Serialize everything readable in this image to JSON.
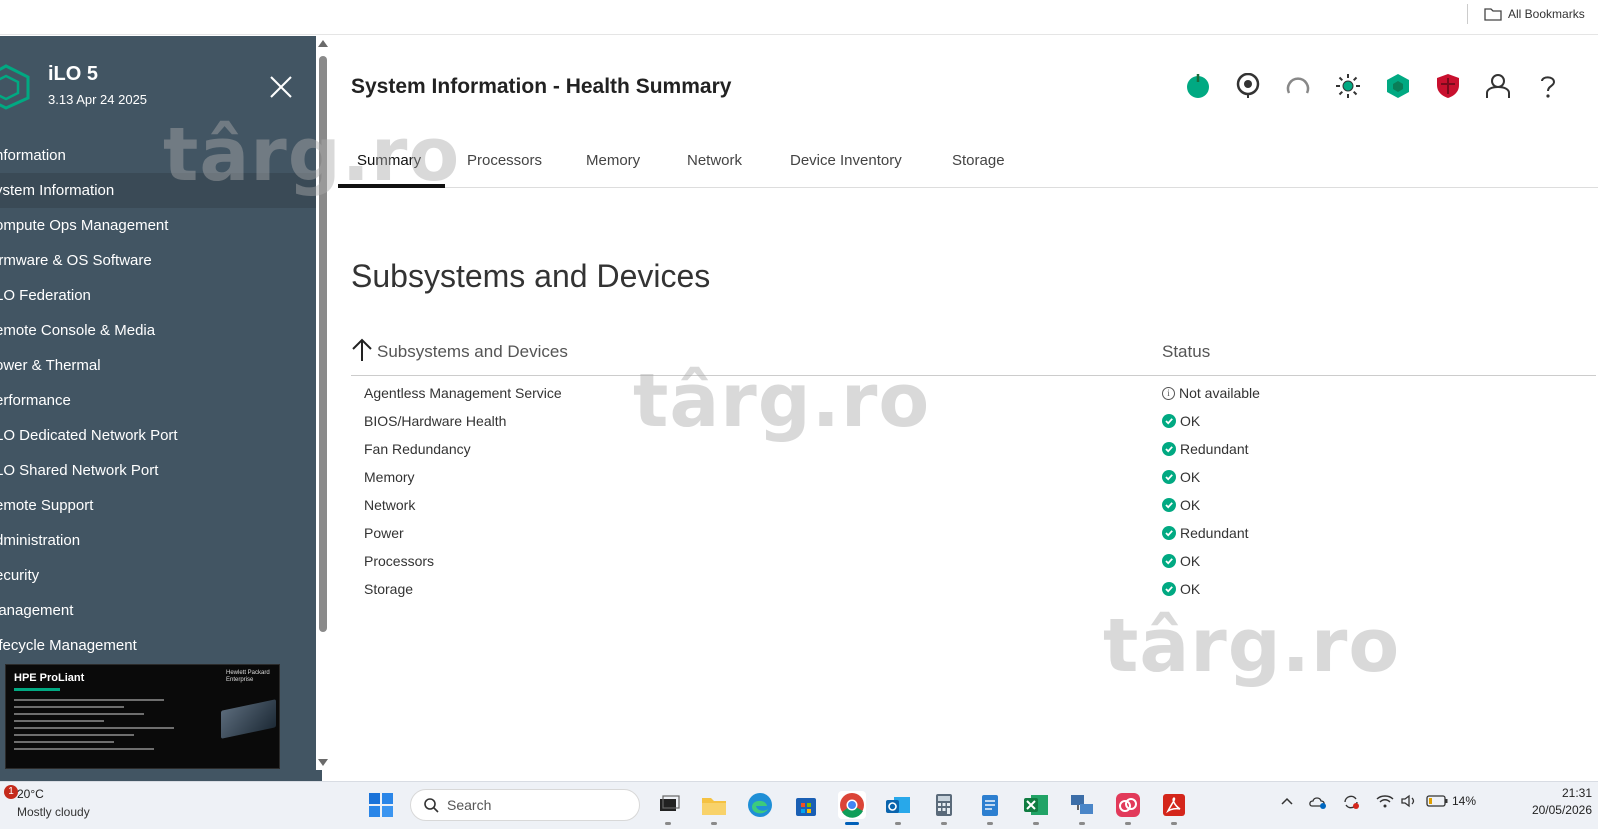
{
  "browser": {
    "bookmarks_label": "All Bookmarks"
  },
  "sidebar": {
    "brand_title": "iLO 5",
    "brand_version": "3.13 Apr 24 2025",
    "items": [
      {
        "label": "nformation"
      },
      {
        "label": "ystem Information"
      },
      {
        "label": "ompute Ops Management"
      },
      {
        "label": "irmware & OS Software"
      },
      {
        "label": "LO Federation"
      },
      {
        "label": "emote Console & Media"
      },
      {
        "label": "ower & Thermal"
      },
      {
        "label": "erformance"
      },
      {
        "label": "LO Dedicated Network Port"
      },
      {
        "label": "LO Shared Network Port"
      },
      {
        "label": "emote Support"
      },
      {
        "label": "dministration"
      },
      {
        "label": "ecurity"
      },
      {
        "label": "lanagement"
      },
      {
        "label": "ifecycle Management"
      }
    ],
    "thumbnail": {
      "title": "HPE ProLiant",
      "brand": "Hewlett Packard Enterprise"
    }
  },
  "header": {
    "title": "System Information - Health Summary"
  },
  "status_icons": [
    "power-icon",
    "uid-indicator-icon",
    "loading-spinner-icon",
    "health-sun-icon",
    "health-hexagon-icon",
    "security-shield-icon",
    "user-icon",
    "help-icon"
  ],
  "tabs": [
    {
      "label": "Summary"
    },
    {
      "label": "Processors"
    },
    {
      "label": "Memory"
    },
    {
      "label": "Network"
    },
    {
      "label": "Device Inventory"
    },
    {
      "label": "Storage"
    }
  ],
  "section": {
    "title": "Subsystems and Devices"
  },
  "table": {
    "columns": [
      "Subsystems and Devices",
      "Status"
    ],
    "rows": [
      {
        "name": "Agentless Management Service",
        "status": "Not available",
        "state": "info"
      },
      {
        "name": "BIOS/Hardware Health",
        "status": "OK",
        "state": "ok"
      },
      {
        "name": "Fan Redundancy",
        "status": "Redundant",
        "state": "ok"
      },
      {
        "name": "Memory",
        "status": "OK",
        "state": "ok"
      },
      {
        "name": "Network",
        "status": "OK",
        "state": "ok"
      },
      {
        "name": "Power",
        "status": "Redundant",
        "state": "ok"
      },
      {
        "name": "Processors",
        "status": "OK",
        "state": "ok"
      },
      {
        "name": "Storage",
        "status": "OK",
        "state": "ok"
      }
    ]
  },
  "watermark": "târg.ro",
  "taskbar": {
    "weather_badge": "1",
    "weather_temp": "20°C",
    "weather_desc": "Mostly cloudy",
    "search_placeholder": "Search",
    "battery": "14%",
    "time": "21:31",
    "date": "20/05/2026"
  },
  "colors": {
    "sidebar_bg": "#425563",
    "accent": "#01a982",
    "status_ok": "#01a982",
    "security_red": "#c8102e"
  }
}
